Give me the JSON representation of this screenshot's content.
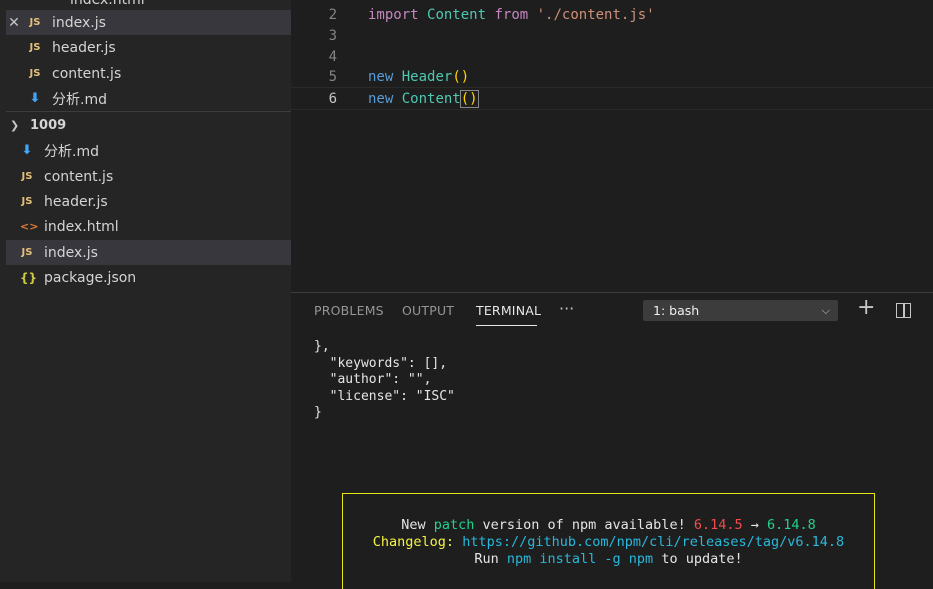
{
  "explorer": {
    "partial_top_item": "index.html",
    "open_folder_items": [
      {
        "label": "index.js",
        "icon": "JS",
        "selected": true
      },
      {
        "label": "header.js",
        "icon": "JS"
      },
      {
        "label": "content.js",
        "icon": "JS"
      },
      {
        "label": "分析.md",
        "icon": "markdown-icon"
      }
    ],
    "folder": {
      "name": "1009"
    },
    "folder_items": [
      {
        "label": "分析.md",
        "icon": "markdown-icon"
      },
      {
        "label": "content.js",
        "icon": "JS"
      },
      {
        "label": "header.js",
        "icon": "JS"
      },
      {
        "label": "index.html",
        "icon": "<>"
      },
      {
        "label": "index.js",
        "icon": "JS",
        "selected": true
      },
      {
        "label": "package.json",
        "icon": "{}"
      }
    ]
  },
  "editor": {
    "lines": [
      {
        "n": "2",
        "kw": "import",
        "cls": "Content",
        "from": "from",
        "str": "'./content.js'"
      },
      {
        "n": "3"
      },
      {
        "n": "4"
      },
      {
        "n": "5",
        "kw": "new",
        "cls": "Header",
        "paren": "()"
      },
      {
        "n": "6",
        "kw": "new",
        "cls": "Content",
        "paren": "()"
      }
    ]
  },
  "panel": {
    "tabs": {
      "problems": "PROBLEMS",
      "output": "OUTPUT",
      "terminal": "TERMINAL",
      "more": "···"
    },
    "terminal_select": "1: bash",
    "terminal_lines": [
      "},",
      "  \"keywords\": [],",
      "  \"author\": \"\",",
      "  \"license\": \"ISC\"",
      "}"
    ],
    "npm_notice": {
      "l1_a": "New ",
      "l1_patch": "patch",
      "l1_b": " version of npm available! ",
      "l1_old": "6.14.5",
      "l1_arrow": " → ",
      "l1_new": "6.14.8",
      "l2_label": "Changelog: ",
      "l2_url": "https://github.com/npm/cli/releases/tag/v6.14.8",
      "l3_a": "Run ",
      "l3_cmd": "npm install -g npm",
      "l3_b": " to update!"
    }
  },
  "colors": {
    "accent_yellow": "#e5e510",
    "keyword_new": "#569cd6",
    "keyword_import": "#c586c0",
    "class": "#4ec9b0",
    "string": "#ce9178"
  }
}
